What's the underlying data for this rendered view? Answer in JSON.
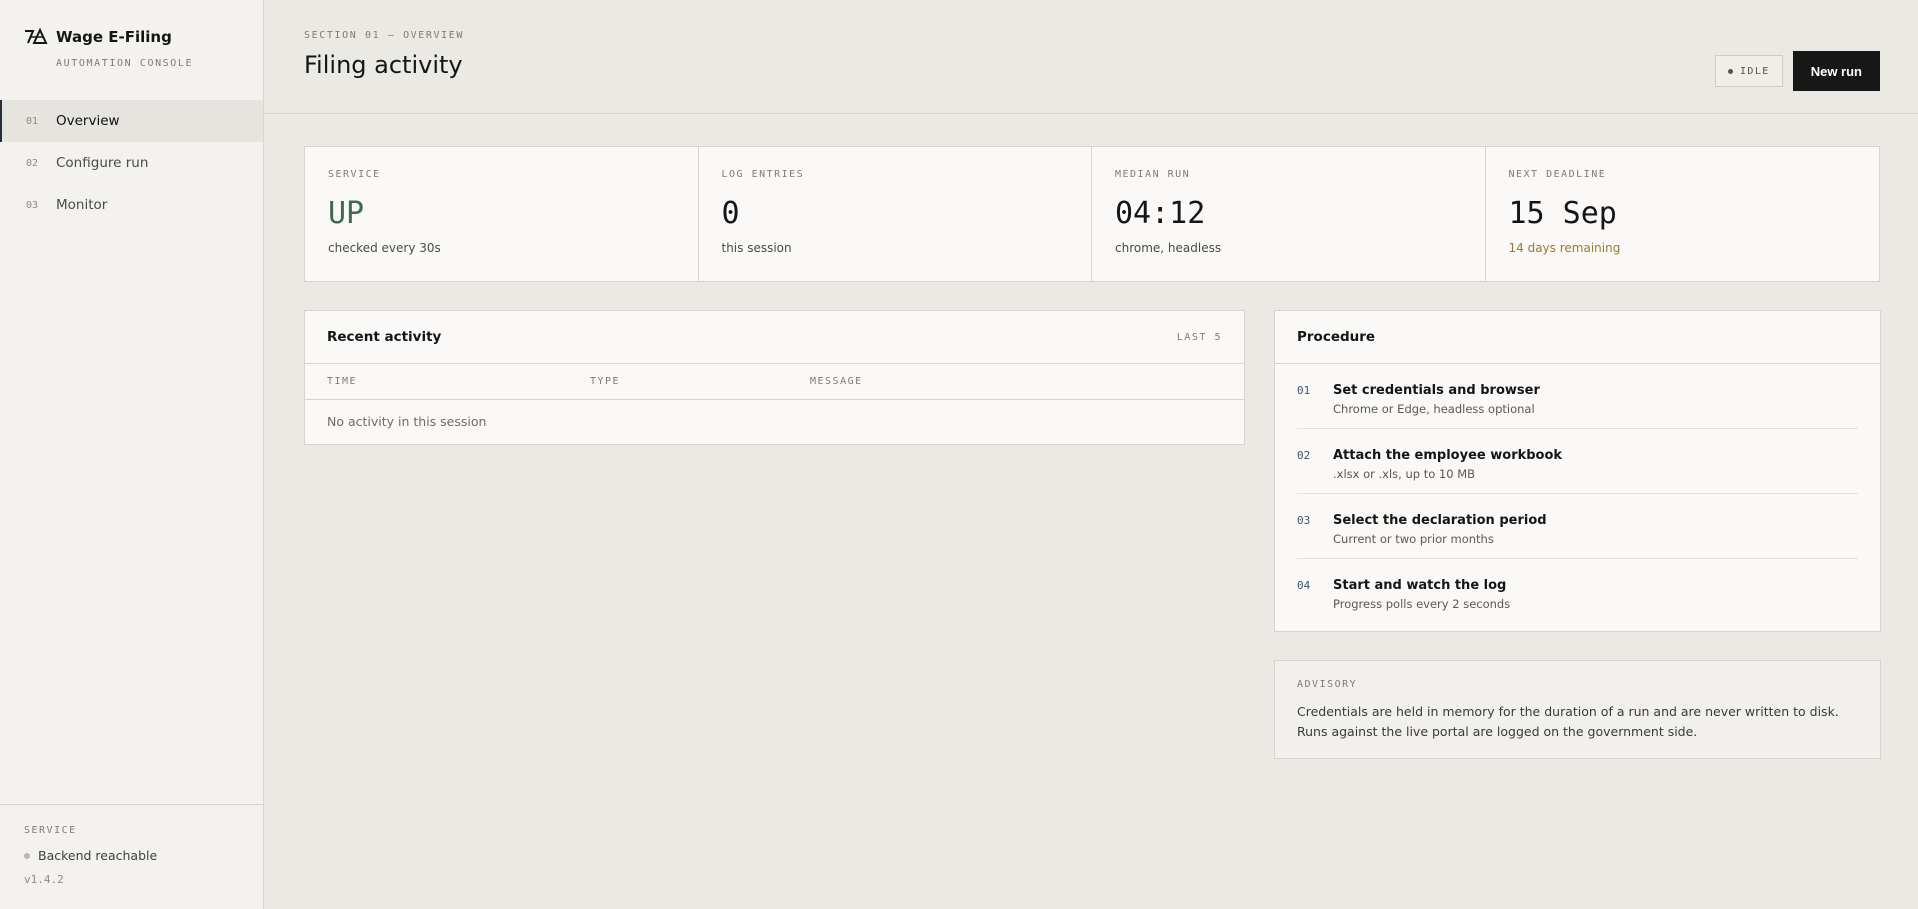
{
  "brand": {
    "title": "Wage E-Filing",
    "subtitle": "AUTOMATION CONSOLE"
  },
  "nav": [
    {
      "num": "01",
      "label": "Overview",
      "active": true
    },
    {
      "num": "02",
      "label": "Configure run",
      "active": false
    },
    {
      "num": "03",
      "label": "Monitor",
      "active": false
    }
  ],
  "sidebar_footer": {
    "caption": "SERVICE",
    "status": "Backend reachable",
    "version": "v1.4.2"
  },
  "header": {
    "eyebrow": "SECTION 01 — OVERVIEW",
    "title": "Filing activity",
    "status_pill": "IDLE",
    "primary_button": "New run"
  },
  "stats": [
    {
      "label": "SERVICE",
      "value": "UP",
      "sub": "checked every 30s"
    },
    {
      "label": "LOG ENTRIES",
      "value": "0",
      "sub": "this session"
    },
    {
      "label": "MEDIAN RUN",
      "value": "04:12",
      "sub": "chrome, headless"
    },
    {
      "label": "NEXT DEADLINE",
      "value": "15 Sep",
      "sub": "14 days remaining"
    }
  ],
  "activity": {
    "title": "Recent activity",
    "meta": "LAST 5",
    "columns": [
      "TIME",
      "TYPE",
      "MESSAGE"
    ],
    "empty": "No activity in this session"
  },
  "procedure": {
    "title": "Procedure",
    "steps": [
      {
        "num": "01",
        "title": "Set credentials and browser",
        "desc": "Chrome or Edge, headless optional"
      },
      {
        "num": "02",
        "title": "Attach the employee workbook",
        "desc": ".xlsx or .xls, up to 10 MB"
      },
      {
        "num": "03",
        "title": "Select the declaration period",
        "desc": "Current or two prior months"
      },
      {
        "num": "04",
        "title": "Start and watch the log",
        "desc": "Progress polls every 2 seconds"
      }
    ]
  },
  "advisory": {
    "caption": "ADVISORY",
    "text": "Credentials are held in memory for the duration of a run and are never written to disk. Runs against the live portal are logged on the government side."
  },
  "colors": {
    "accent": "#171717",
    "service_up": "#3e6b4f",
    "deadline_warn": "#9a7a2e",
    "background": "#ebe9e4"
  }
}
